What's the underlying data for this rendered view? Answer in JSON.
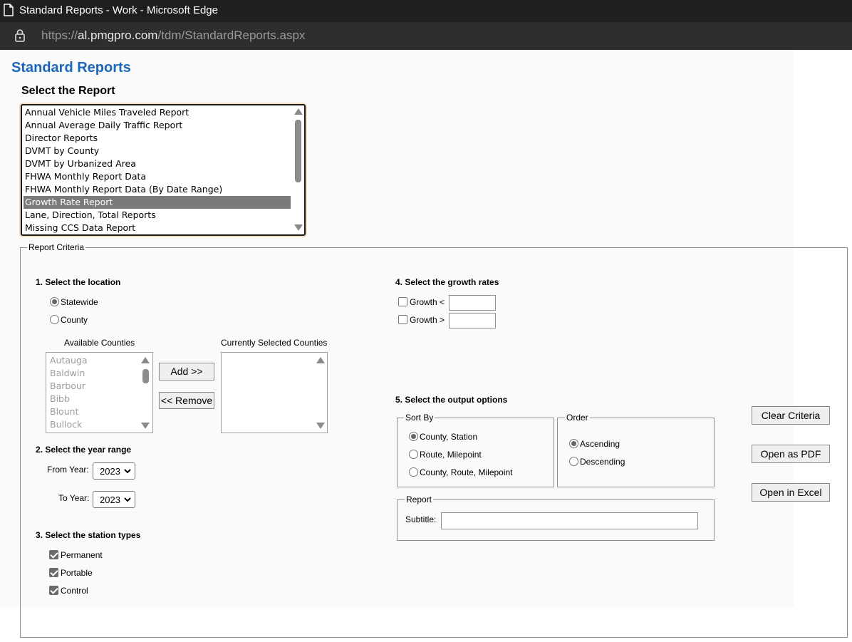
{
  "browser": {
    "window_title": "Standard Reports - Work - Microsoft Edge",
    "url_scheme": "https://",
    "url_host": "al.pmgpro.com",
    "url_path": "/tdm/StandardReports.aspx"
  },
  "page": {
    "title": "Standard Reports",
    "select_report_label": "Select the Report",
    "reports": [
      "Annual Vehicle Miles Traveled Report",
      "Annual Average Daily Traffic Report",
      "Director Reports",
      "DVMT by County",
      "DVMT by Urbanized Area",
      "FHWA Monthly Report Data",
      "FHWA Monthly Report Data (By Date Range)",
      "Growth Rate Report",
      "Lane, Direction, Total Reports",
      "Missing CCS Data Report"
    ],
    "selected_report": "Growth Rate Report"
  },
  "criteria": {
    "legend": "Report Criteria",
    "location": {
      "title": "1. Select the location",
      "statewide_label": "Statewide",
      "county_label": "County",
      "selected": "Statewide",
      "available_label": "Available Counties",
      "selected_label": "Currently Selected Counties",
      "available_counties": [
        "Autauga",
        "Baldwin",
        "Barbour",
        "Bibb",
        "Blount",
        "Bullock"
      ],
      "selected_counties": [],
      "add_button": "Add >>",
      "remove_button": "<< Remove"
    },
    "years": {
      "title": "2. Select the year range",
      "from_label": "From Year:",
      "to_label": "To Year:",
      "from_value": "2023",
      "to_value": "2023"
    },
    "stations": {
      "title": "3. Select the station types",
      "items": [
        {
          "label": "Permanent",
          "checked": true
        },
        {
          "label": "Portable",
          "checked": true
        },
        {
          "label": "Control",
          "checked": true
        }
      ]
    },
    "growth": {
      "title": "4. Select the growth rates",
      "less_label": "Growth <",
      "greater_label": "Growth >",
      "less_value": "",
      "greater_value": ""
    },
    "output": {
      "title": "5. Select the output options",
      "sort_legend": "Sort By",
      "sort_options": [
        "County, Station",
        "Route, Milepoint",
        "County, Route, Milepoint"
      ],
      "sort_selected": "County, Station",
      "order_legend": "Order",
      "order_options": [
        "Ascending",
        "Descending"
      ],
      "order_selected": "Ascending",
      "report_legend": "Report",
      "subtitle_label": "Subtitle:",
      "subtitle_value": ""
    },
    "buttons": {
      "clear": "Clear Criteria",
      "pdf": "Open as PDF",
      "excel": "Open in Excel"
    }
  }
}
